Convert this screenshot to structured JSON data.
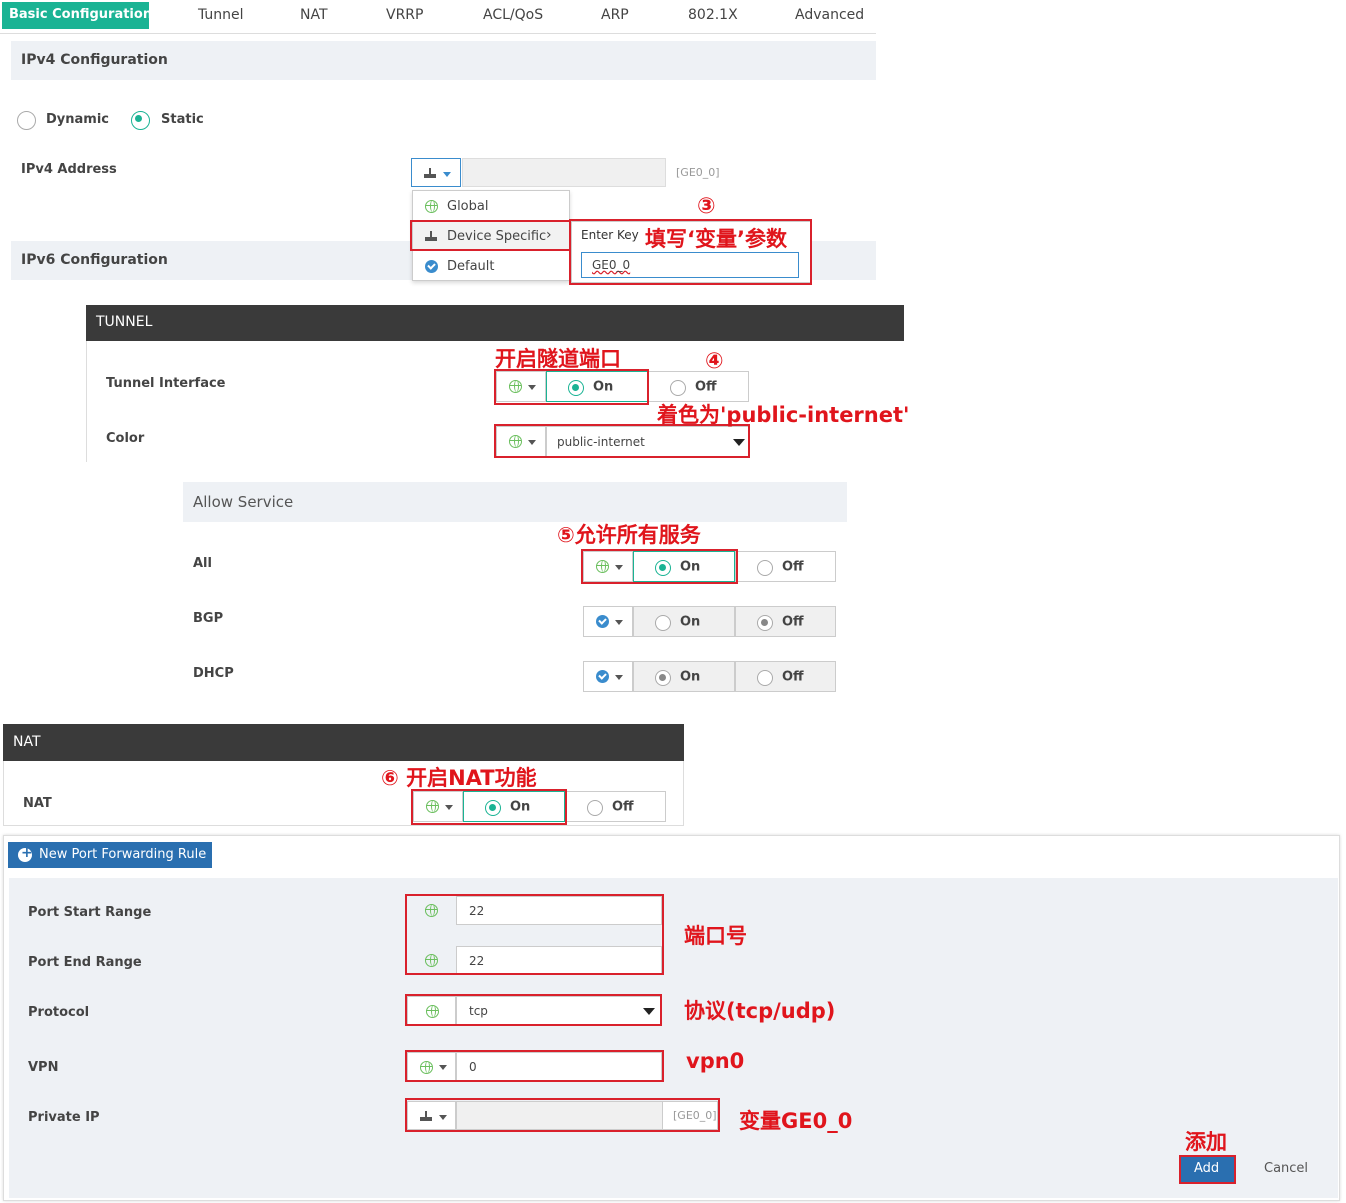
{
  "tabs": [
    {
      "label": "Basic Configuration",
      "active": true
    },
    {
      "label": "Tunnel"
    },
    {
      "label": "NAT"
    },
    {
      "label": "VRRP"
    },
    {
      "label": "ACL/QoS"
    },
    {
      "label": "ARP"
    },
    {
      "label": "802.1X"
    },
    {
      "label": "Advanced"
    }
  ],
  "ipv4": {
    "title": "IPv4 Configuration",
    "dynamic_label": "Dynamic",
    "static_label": "Static",
    "address_label": "IPv4 Address",
    "address_hint": "[GE0_0]"
  },
  "scope_menu": {
    "global": "Global",
    "device_specific": "Device Specific",
    "default": "Default",
    "chevron": "›"
  },
  "enter_key": {
    "label": "Enter Key",
    "value": "GE0_0"
  },
  "ipv6": {
    "title": "IPv6 Configuration"
  },
  "tunnel": {
    "title": "TUNNEL",
    "interface_label": "Tunnel Interface",
    "color_label": "Color",
    "on": "On",
    "off": "Off",
    "color_value": "public-internet"
  },
  "allow_service": {
    "title": "Allow Service",
    "rows": [
      {
        "label": "All",
        "on": "On",
        "off": "Off"
      },
      {
        "label": "BGP",
        "on": "On",
        "off": "Off"
      },
      {
        "label": "DHCP",
        "on": "On",
        "off": "Off"
      }
    ]
  },
  "nat": {
    "title": "NAT",
    "label": "NAT",
    "on": "On",
    "off": "Off"
  },
  "port_forwarding": {
    "new_rule_button": "New Port Forwarding Rule",
    "port_start_label": "Port Start Range",
    "port_start_value": "22",
    "port_end_label": "Port End Range",
    "port_end_value": "22",
    "protocol_label": "Protocol",
    "protocol_value": "tcp",
    "vpn_label": "VPN",
    "vpn_value": "0",
    "private_ip_label": "Private IP",
    "private_ip_hint": "[GE0_0]",
    "add_button": "Add",
    "cancel_button": "Cancel"
  },
  "annotations": {
    "a3_num": "③",
    "a3_text": "填写‘变量’参数",
    "a4_title": "开启隧道端口",
    "a4_num": "④",
    "a4_color": "着色为'public-internet'",
    "a5": "⑤允许所有服务",
    "a6": "⑥ 开启NAT功能",
    "port": "端口号",
    "protocol": "协议(tcp/udp)",
    "vpn": "vpn0",
    "var": "变量GE0_0",
    "add": "添加"
  },
  "colors": {
    "accent": "#1ab394",
    "annotation": "#e0151c",
    "dark_header": "#3a3a3a",
    "button_blue": "#2a6fb0"
  }
}
